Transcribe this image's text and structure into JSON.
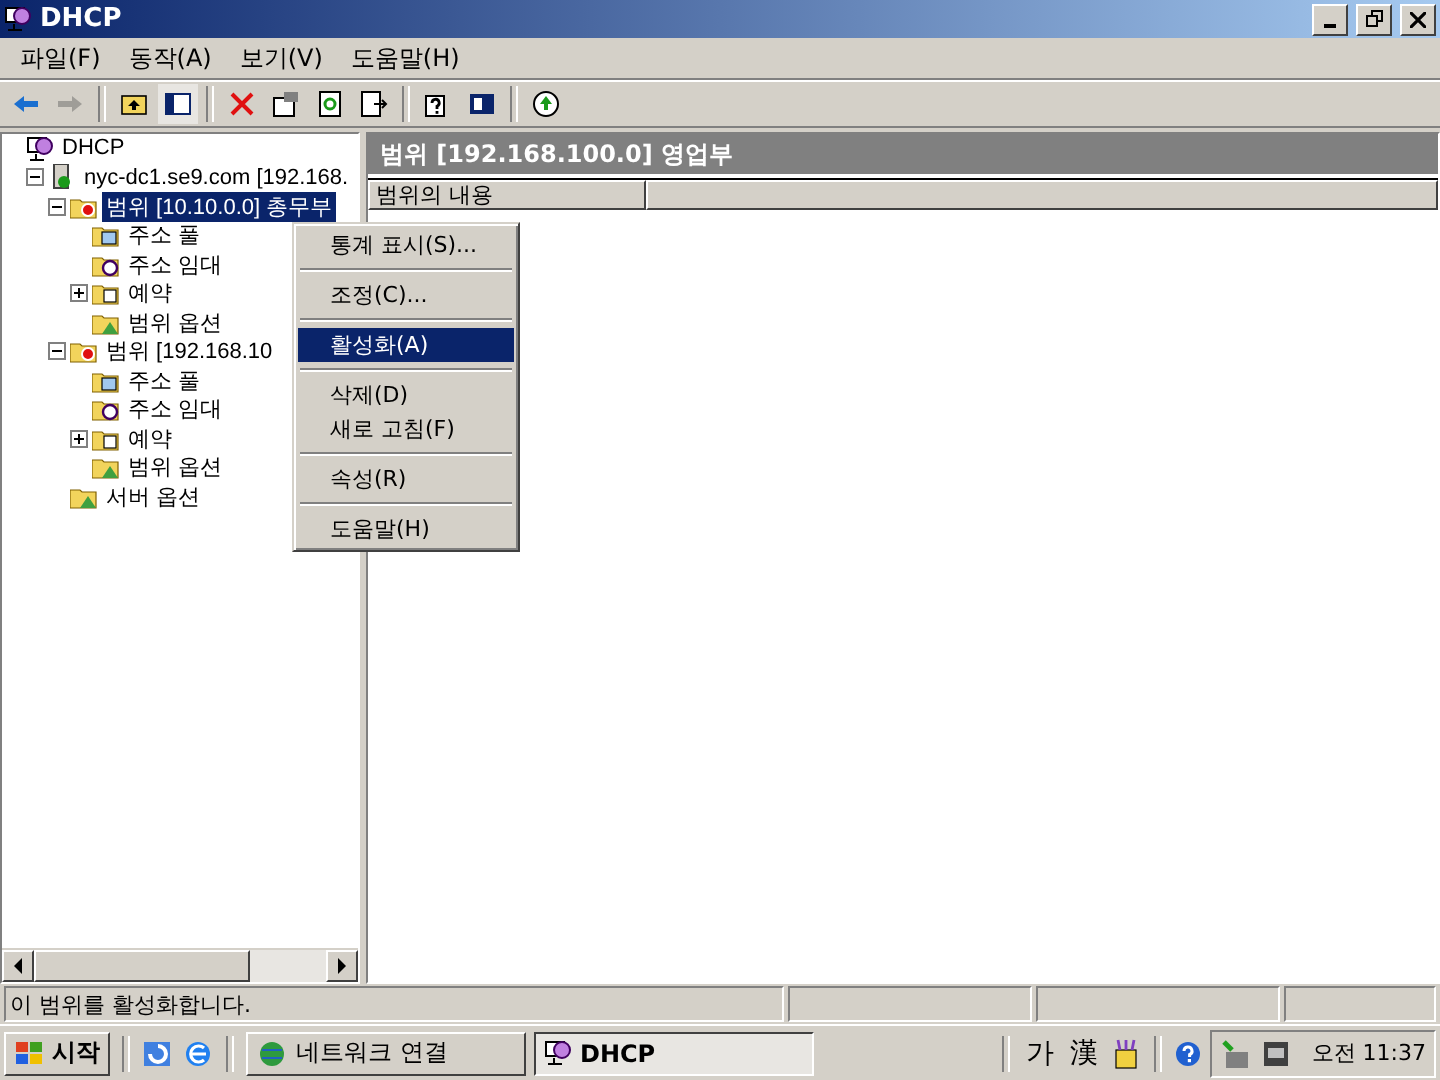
{
  "window": {
    "title": "DHCP"
  },
  "menu_bar": [
    "파일(F)",
    "동작(A)",
    "보기(V)",
    "도움말(H)"
  ],
  "toolbar": [
    {
      "kind": "back",
      "disabled": false
    },
    {
      "kind": "forward",
      "disabled": true
    },
    {
      "kind": "sep"
    },
    {
      "kind": "up"
    },
    {
      "kind": "tree",
      "selected": true
    },
    {
      "kind": "sep"
    },
    {
      "kind": "delete"
    },
    {
      "kind": "properties"
    },
    {
      "kind": "refresh"
    },
    {
      "kind": "export"
    },
    {
      "kind": "sep"
    },
    {
      "kind": "help"
    },
    {
      "kind": "panel"
    },
    {
      "kind": "sep"
    },
    {
      "kind": "activate"
    }
  ],
  "tree": [
    {
      "label": "DHCP",
      "kind": "dhcp",
      "children": [
        {
          "label": "nyc-dc1.se9.com [192.168.",
          "kind": "server",
          "expanded": true,
          "children": [
            {
              "label": "범위 [10.10.0.0] 총무부",
              "kind": "scope",
              "expanded": true,
              "selected": true,
              "children": [
                {
                  "label": "주소 풀",
                  "kind": "pool"
                },
                {
                  "label": "주소 임대",
                  "kind": "lease"
                },
                {
                  "label": "예약",
                  "kind": "reserve",
                  "expanded": false
                },
                {
                  "label": "범위 옵션",
                  "kind": "options"
                }
              ]
            },
            {
              "label": "범위 [192.168.10",
              "kind": "scope",
              "expanded": true,
              "selected": false,
              "children": [
                {
                  "label": "주소 풀",
                  "kind": "pool"
                },
                {
                  "label": "주소 임대",
                  "kind": "lease"
                },
                {
                  "label": "예약",
                  "kind": "reserve",
                  "expanded": false
                },
                {
                  "label": "범위 옵션",
                  "kind": "options"
                }
              ]
            },
            {
              "label": "서버 옵션",
              "kind": "options"
            }
          ]
        }
      ]
    }
  ],
  "detail": {
    "title": "범위 [192.168.100.0] 영업부",
    "columns": [
      "범위의 내용"
    ]
  },
  "context_menu": [
    {
      "kind": "item",
      "label": "통계 표시(S)...",
      "selected": false
    },
    {
      "kind": "sep"
    },
    {
      "kind": "item",
      "label": "조정(C)...",
      "selected": false
    },
    {
      "kind": "sep"
    },
    {
      "kind": "item",
      "label": "활성화(A)",
      "selected": true
    },
    {
      "kind": "sep"
    },
    {
      "kind": "item",
      "label": "삭제(D)",
      "selected": false
    },
    {
      "kind": "item",
      "label": "새로 고침(F)",
      "selected": false
    },
    {
      "kind": "sep"
    },
    {
      "kind": "item",
      "label": "속성(R)",
      "selected": false
    },
    {
      "kind": "sep"
    },
    {
      "kind": "item",
      "label": "도움말(H)",
      "selected": false
    }
  ],
  "status_bar": "이 범위를 활성화합니다.",
  "taskbar": {
    "start": "시작",
    "tasks": [
      {
        "label": "네트워크 연결",
        "kind": "network",
        "selected": false
      },
      {
        "label": "DHCP",
        "kind": "dhcp",
        "selected": true
      }
    ],
    "tray": [
      "가",
      "漢"
    ],
    "clock": "오전 11:37"
  }
}
